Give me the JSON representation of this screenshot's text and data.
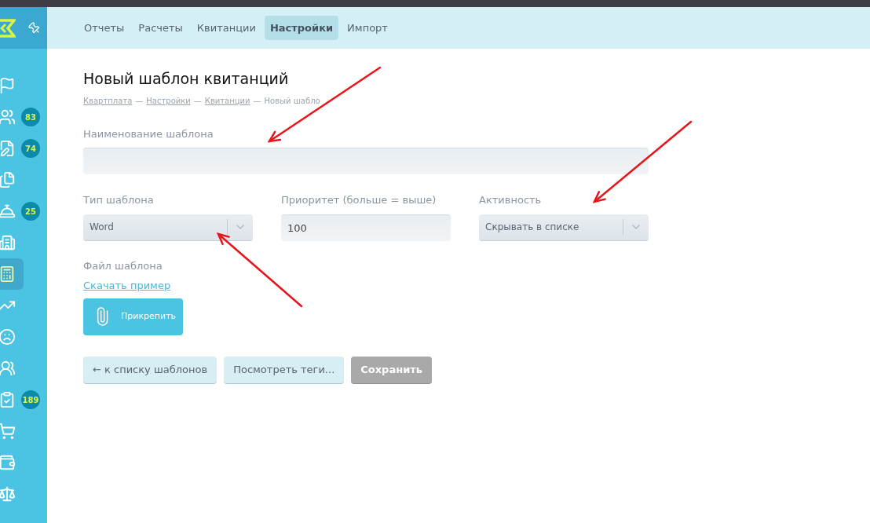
{
  "nav_tabs": [
    {
      "label": "Отчеты",
      "selected": false
    },
    {
      "label": "Расчеты",
      "selected": false
    },
    {
      "label": "Квитанции",
      "selected": false
    },
    {
      "label": "Настройки",
      "selected": true
    },
    {
      "label": "Импорт",
      "selected": false
    }
  ],
  "sidebar": {
    "items": [
      {
        "kind": "flag",
        "selected": false
      },
      {
        "kind": "people",
        "badge": "83",
        "selected": false
      },
      {
        "kind": "edit",
        "badge": "74",
        "selected": false
      },
      {
        "kind": "files",
        "selected": false
      },
      {
        "kind": "desk",
        "badge": "25",
        "selected": false
      },
      {
        "kind": "building",
        "selected": false
      },
      {
        "kind": "calculator",
        "selected": true
      },
      {
        "kind": "chart",
        "selected": false
      },
      {
        "kind": "sad",
        "selected": false
      },
      {
        "kind": "team",
        "selected": false
      },
      {
        "kind": "clipboard",
        "badge": "189",
        "selected": false
      },
      {
        "kind": "cart",
        "selected": false
      },
      {
        "kind": "wallet",
        "selected": false
      },
      {
        "kind": "scale",
        "selected": false
      }
    ]
  },
  "page_title": "Новый шаблон квитанций",
  "breadcrumbs": [
    {
      "label": "Квартплата",
      "link": true
    },
    {
      "separator": "—",
      "label": "Настройки",
      "link": true
    },
    {
      "separator": "—",
      "label": "Квитанции",
      "link": true
    },
    {
      "separator": "—",
      "label": "Новый шабло",
      "link": false
    }
  ],
  "name_field": {
    "label": "Наименование шаблона"
  },
  "type_field": {
    "label": "Тип шаблона",
    "value": "Word"
  },
  "priority_field": {
    "label": "Приоритет (больше = выше)",
    "value": "100"
  },
  "activity_field": {
    "label": "Активность",
    "value": "Скрывать в списке"
  },
  "file_section": {
    "label": "Файл шаблона",
    "sample_link": "Скачать пример",
    "attach_button": "Прикрепить"
  },
  "buttons": [
    {
      "label": "← к списку шаблонов",
      "disabled": false
    },
    {
      "label": "Посмотреть теги...",
      "disabled": false
    },
    {
      "label": "Сохранить",
      "disabled": true
    }
  ]
}
